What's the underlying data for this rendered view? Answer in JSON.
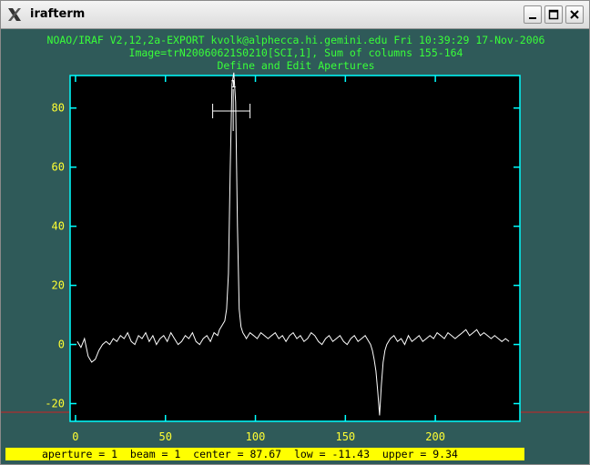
{
  "window": {
    "title": "irafterm",
    "icons": {
      "app": "x-logo-icon",
      "minimize": "minimize-icon",
      "maximize": "maximize-icon",
      "close": "close-icon"
    }
  },
  "header": {
    "line1": "NOAO/IRAF V2,12,2a-EXPORT kvolk@alphecca.hi.gemini.edu Fri 10:39:29 17-Nov-2006",
    "line2": "Image=trN20060621S0210[SCI,1], Sum of columns 155-164",
    "line3": "Define and Edit Apertures"
  },
  "aperture_marker": {
    "label": "1",
    "center": 87.67,
    "low": -11.43,
    "upper": 9.34
  },
  "status": {
    "text": "aperture = 1  beam = 1  center = 87.67  low = -11.43  upper = 9.34"
  },
  "colors": {
    "background": "#2f5a59",
    "axes": "#00ffff",
    "ticks_text": "#ffff33",
    "header_text": "#39ff39",
    "trace": "#ffffff",
    "status_bg": "#ffff00",
    "cursor_line": "#cc2222"
  },
  "chart_data": {
    "type": "line",
    "title": "",
    "xlabel": "",
    "ylabel": "",
    "xlim": [
      -3,
      247
    ],
    "ylim": [
      -26,
      91
    ],
    "xticks": [
      0,
      50,
      100,
      150,
      200
    ],
    "yticks": [
      -20,
      0,
      20,
      40,
      60,
      80
    ],
    "grid": false,
    "series": [
      {
        "x": [
          1,
          3,
          5,
          7,
          9,
          11,
          13,
          15,
          17,
          19,
          21,
          23,
          25,
          27,
          29,
          31,
          33,
          35,
          37,
          39,
          41,
          43,
          45,
          47,
          49,
          51,
          53,
          55,
          57,
          59,
          61,
          63,
          65,
          67,
          69,
          71,
          73,
          75,
          77,
          79,
          80,
          81,
          82,
          83,
          84,
          85,
          86,
          87,
          88,
          89,
          90,
          91,
          92,
          93,
          94,
          95,
          96,
          97,
          99,
          101,
          103,
          105,
          107,
          109,
          111,
          113,
          115,
          117,
          119,
          121,
          123,
          125,
          127,
          129,
          131,
          133,
          135,
          137,
          139,
          141,
          143,
          145,
          147,
          149,
          151,
          153,
          155,
          157,
          159,
          161,
          163,
          164,
          165,
          166,
          167,
          168,
          169,
          170,
          171,
          172,
          173,
          174,
          175,
          177,
          179,
          181,
          183,
          185,
          187,
          189,
          191,
          193,
          195,
          197,
          199,
          201,
          203,
          205,
          207,
          209,
          211,
          213,
          215,
          217,
          219,
          221,
          223,
          225,
          227,
          229,
          231,
          233,
          235,
          237,
          239,
          241
        ],
        "y": [
          1,
          -1,
          2,
          -4,
          -6,
          -5,
          -2,
          0,
          1,
          0,
          2,
          1,
          3,
          2,
          4,
          1,
          0,
          3,
          2,
          4,
          1,
          3,
          0,
          2,
          3,
          1,
          4,
          2,
          0,
          1,
          3,
          2,
          4,
          1,
          0,
          2,
          3,
          1,
          4,
          3,
          5,
          6,
          7,
          8,
          12,
          24,
          60,
          88,
          92,
          82,
          40,
          12,
          6,
          4,
          3,
          2,
          3,
          4,
          3,
          2,
          4,
          3,
          2,
          3,
          4,
          2,
          3,
          1,
          3,
          4,
          2,
          3,
          1,
          2,
          4,
          3,
          1,
          0,
          2,
          3,
          1,
          2,
          3,
          1,
          0,
          2,
          3,
          1,
          2,
          3,
          1,
          0,
          -2,
          -5,
          -9,
          -16,
          -24,
          -14,
          -6,
          -2,
          0,
          1,
          2,
          3,
          1,
          2,
          0,
          3,
          1,
          2,
          3,
          1,
          2,
          3,
          2,
          4,
          3,
          2,
          4,
          3,
          2,
          3,
          4,
          5,
          3,
          4,
          5,
          3,
          4,
          3,
          2,
          3,
          2,
          1,
          2,
          1
        ]
      }
    ]
  }
}
